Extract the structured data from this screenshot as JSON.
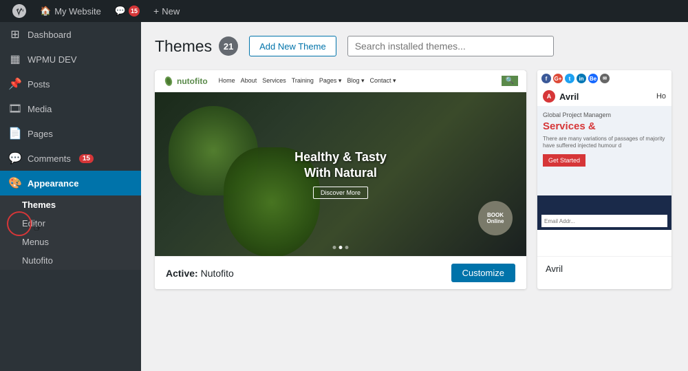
{
  "admin_bar": {
    "wp_label": "WordPress",
    "site_label": "My Website",
    "comments_count": "15",
    "new_label": "New"
  },
  "sidebar": {
    "dashboard_label": "Dashboard",
    "wpmu_label": "WPMU DEV",
    "posts_label": "Posts",
    "media_label": "Media",
    "pages_label": "Pages",
    "comments_label": "Comments",
    "comments_count": "15",
    "appearance_label": "Appearance",
    "themes_label": "Themes",
    "editor_label": "Editor",
    "menus_label": "Menus",
    "nutofito_label": "Nutofito"
  },
  "main": {
    "title": "Themes",
    "count": "21",
    "add_new_label": "Add New Theme",
    "search_placeholder": "Search installed themes...",
    "active_theme_label": "Active:",
    "active_theme_name": "Nutofito",
    "customize_label": "Customize",
    "second_theme_name": "Avril",
    "hero_title": "Healthy & Tasty\nWith Natural",
    "hero_btn": "Discover More",
    "book_online": "BOOK\nOnline",
    "avril_subtitle": "Global Project Managem",
    "avril_title_prefix": "Services",
    "avril_title_suffix": " &",
    "avril_desc": "There are many variations of passages of\nmajority have suffered injected humour d",
    "avril_cta": "Get Started"
  }
}
